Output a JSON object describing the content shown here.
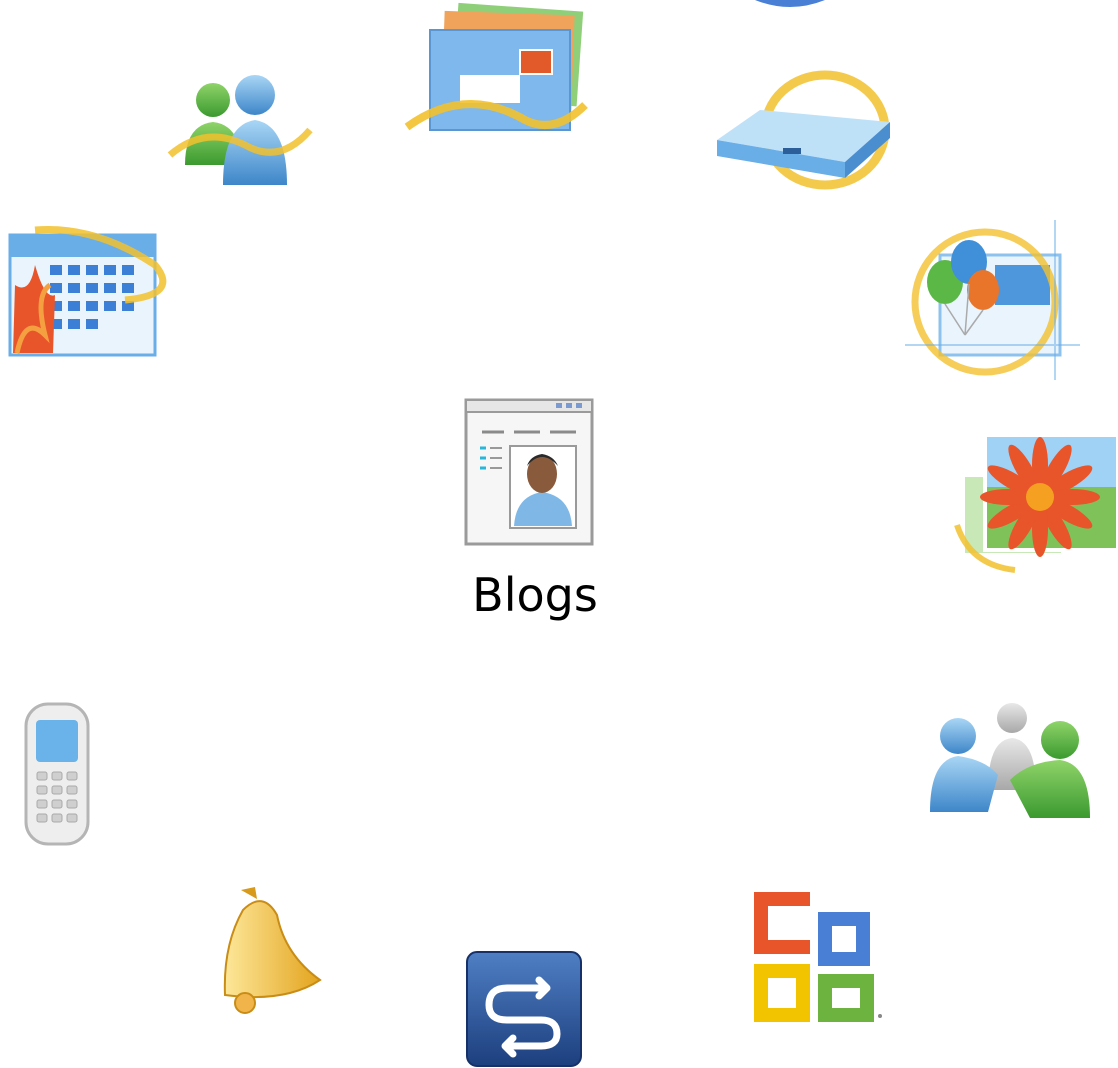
{
  "center": {
    "label": "Blogs",
    "icon": "blog-page-icon"
  },
  "icons": [
    "messenger-buddies-icon",
    "mail-envelope-icon",
    "writer-drive-icon",
    "calendar-icon",
    "events-balloons-icon",
    "photo-gallery-icon",
    "mobile-phone-icon",
    "sharing-people-icon",
    "alerts-bell-icon",
    "sync-arrows-icon",
    "office-logo-icon"
  ],
  "colors": {
    "swoosh": "#f2c12e",
    "accent_blue": "#3f8fd9",
    "accent_green": "#5bb847",
    "accent_orange": "#e8552a"
  }
}
